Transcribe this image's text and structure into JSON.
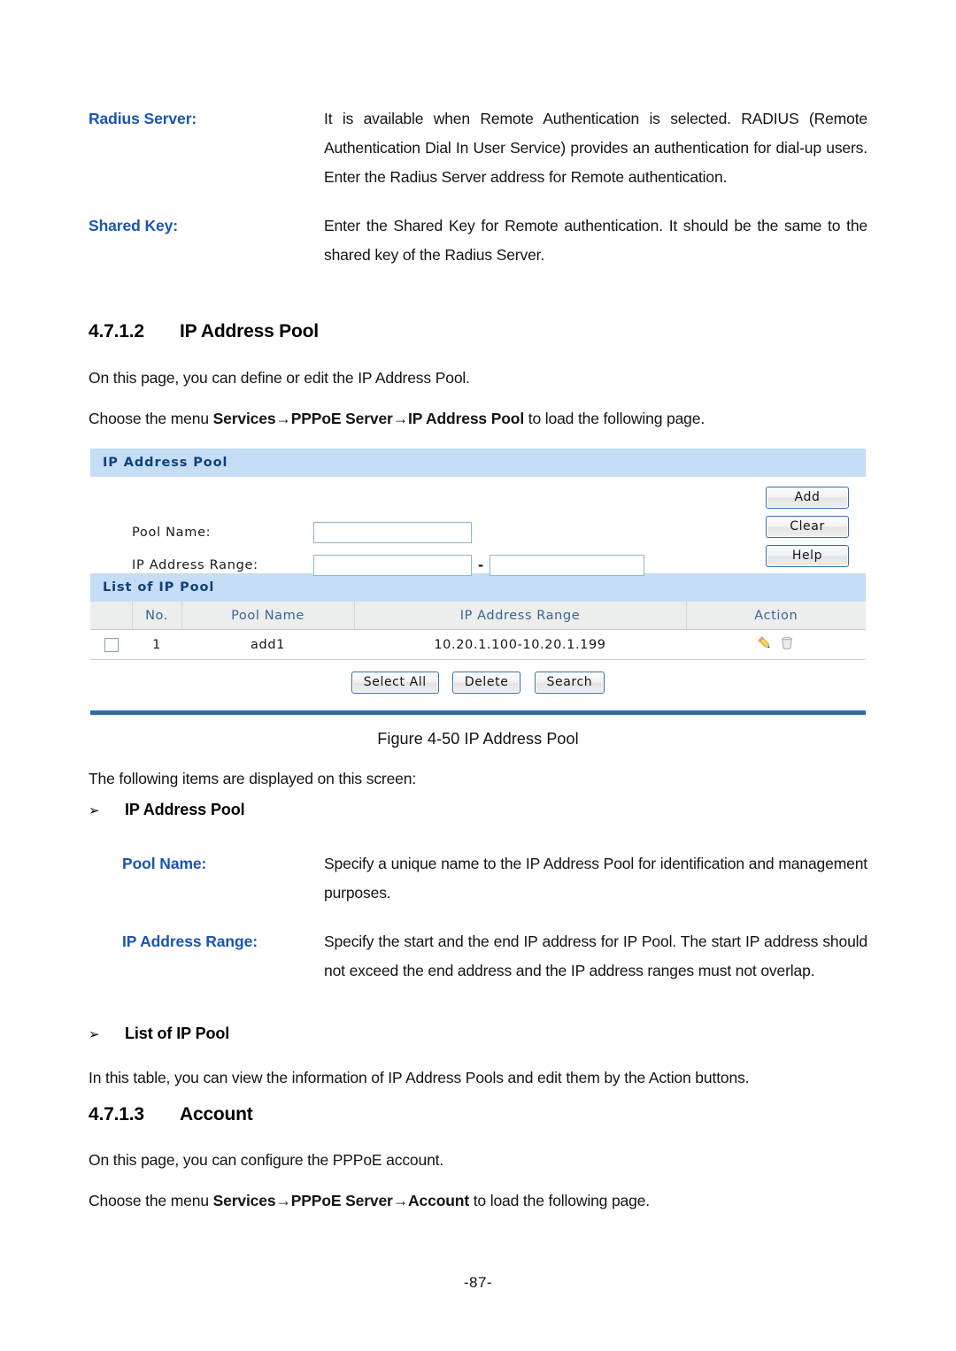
{
  "definitions_top": [
    {
      "term": "Radius Server:",
      "description": "It is available when Remote Authentication is selected. RADIUS (Remote Authentication Dial In User Service) provides an authentication for dial-up users. Enter the Radius Server address for Remote authentication."
    },
    {
      "term": "Shared Key:",
      "description": "Enter the Shared Key for Remote authentication. It should be the same to the shared key of the Radius Server."
    }
  ],
  "section_pool": {
    "number": "4.7.1.2",
    "title": "IP Address Pool",
    "intro": "On this page, you can define or edit the IP Address Pool.",
    "menu_prefix": "Choose the menu ",
    "menu_path": "Services→PPPoE Server→IP Address Pool",
    "menu_suffix": " to load the following page."
  },
  "ui": {
    "panel_title": "IP Address Pool",
    "form": {
      "pool_name_label": "Pool Name:",
      "pool_name_value": "",
      "ip_range_label": "IP Address Range:",
      "ip_range_start_value": "",
      "ip_range_end_value": "",
      "range_separator": "-"
    },
    "side_buttons": [
      {
        "label": "Add",
        "name": "add-button"
      },
      {
        "label": "Clear",
        "name": "clear-button"
      },
      {
        "label": "Help",
        "name": "help-button"
      }
    ],
    "list": {
      "title": "List of IP Pool",
      "columns": [
        "",
        "No.",
        "Pool Name",
        "IP Address Range",
        "Action"
      ],
      "rows": [
        {
          "checked": false,
          "no": "1",
          "pool_name": "add1",
          "ip_range": "10.20.1.100-10.20.1.199",
          "actions": [
            "edit-pencil-icon",
            "delete-trash-icon"
          ]
        }
      ]
    },
    "table_buttons": [
      {
        "label": "Select All",
        "name": "select-all-button"
      },
      {
        "label": "Delete",
        "name": "delete-button"
      },
      {
        "label": "Search",
        "name": "search-button"
      }
    ],
    "colors": {
      "panel_header_bg": "#c5ddf5",
      "panel_header_text": "#10407e",
      "table_header_bg": "#eceded",
      "table_header_text": "#3d6493",
      "bottom_rule": "#2e6ca4",
      "button_border": "#3a6ea5",
      "input_border": "#8fb4d9"
    }
  },
  "figure_caption": "Figure 4-50 IP Address Pool",
  "following_items_line": "The following items are displayed on this screen:",
  "bullets": {
    "ip_address_pool": "IP Address Pool",
    "list_of_ip_pool": "List of IP Pool",
    "glyph": "➢"
  },
  "definitions_pool": [
    {
      "term": "Pool Name:",
      "description": "Specify a unique name to the IP Address Pool for identification and management purposes."
    },
    {
      "term": "IP Address Range:",
      "description": "Specify the start and the end IP address for IP Pool. The start IP address should not exceed the end address and the IP address ranges must not overlap."
    }
  ],
  "list_of_ip_pool_note": "In this table, you can view the information of IP Address Pools and edit them by the Action buttons.",
  "section_account": {
    "number": "4.7.1.3",
    "title": "Account",
    "intro": "On this page, you can configure the PPPoE account.",
    "menu_prefix": "Choose the menu ",
    "menu_path": "Services→PPPoE Server→Account",
    "menu_suffix": " to load the following page."
  },
  "page_number": "-87-"
}
